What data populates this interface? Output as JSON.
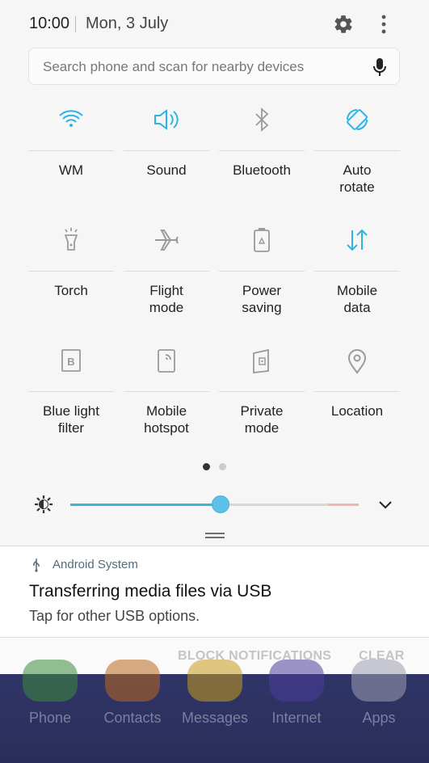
{
  "status": {
    "time": "10:00",
    "date": "Mon, 3 July"
  },
  "search": {
    "placeholder": "Search phone and scan for nearby devices"
  },
  "tiles": [
    {
      "label": "WM",
      "icon": "wifi-icon",
      "active": true
    },
    {
      "label": "Sound",
      "icon": "sound-icon",
      "active": true
    },
    {
      "label": "Bluetooth",
      "icon": "bluetooth-icon",
      "active": false
    },
    {
      "label": "Auto\nrotate",
      "icon": "auto-rotate-icon",
      "active": true
    },
    {
      "label": "Torch",
      "icon": "torch-icon",
      "active": false
    },
    {
      "label": "Flight\nmode",
      "icon": "flight-icon",
      "active": false
    },
    {
      "label": "Power\nsaving",
      "icon": "battery-icon",
      "active": false
    },
    {
      "label": "Mobile\ndata",
      "icon": "mobile-data-icon",
      "active": true
    },
    {
      "label": "Blue light\nfilter",
      "icon": "blue-light-icon",
      "active": false
    },
    {
      "label": "Mobile\nhotspot",
      "icon": "hotspot-icon",
      "active": false
    },
    {
      "label": "Private\nmode",
      "icon": "private-mode-icon",
      "active": false
    },
    {
      "label": "Location",
      "icon": "location-icon",
      "active": false
    }
  ],
  "pager": {
    "pages": 2,
    "current": 1
  },
  "brightness": {
    "level": 0.52
  },
  "notification": {
    "app": "Android System",
    "title": "Transferring media files via USB",
    "text": "Tap for other USB options.",
    "block_label": "BLOCK NOTIFICATIONS",
    "clear_label": "CLEAR"
  },
  "dock": [
    {
      "name": "Phone",
      "color": "#3d8a3a"
    },
    {
      "name": "Contacts",
      "color": "#b9661c"
    },
    {
      "name": "Messages",
      "color": "#c79b1c"
    },
    {
      "name": "Internet",
      "color": "#4d3d9a"
    },
    {
      "name": "Apps",
      "color": "#9c9cae"
    }
  ],
  "colors": {
    "active": "#2fb3e3",
    "inactive": "#9a9a9a"
  }
}
